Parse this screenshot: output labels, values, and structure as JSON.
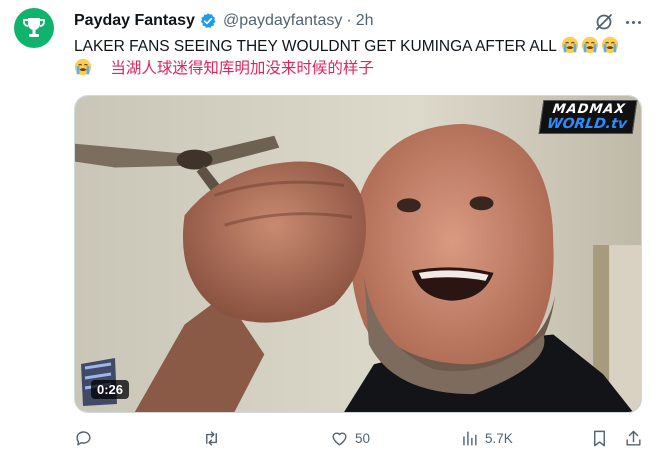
{
  "tweet": {
    "display_name": "Payday Fantasy",
    "handle": "@paydayfantasy",
    "separator": "·",
    "timestamp": "2h",
    "text_line1": "LAKER FANS SEEING THEY WOULDNT GET KUMINGA AFTER ALL",
    "text_line2": "当湖人球迷得知库明加没来时候的样子",
    "emojis": [
      "loudly-crying-face",
      "loudly-crying-face",
      "loudly-crying-face",
      "loudly-crying-face"
    ]
  },
  "media": {
    "watermark_line1": "MADMAX",
    "watermark_line2": "WORLD.tv",
    "duration": "0:26"
  },
  "actions": {
    "reply_count": "",
    "retweet_count": "",
    "like_count": "50",
    "views_count": "5.7K"
  },
  "colors": {
    "avatar_bg": "#10b36c",
    "verified": "#1d9bf0",
    "secondary_text": "#536471",
    "cn_text": "#e0245e"
  },
  "icons": [
    "verified-badge-icon",
    "grok-icon",
    "more-icon",
    "reply-icon",
    "retweet-icon",
    "like-icon",
    "views-icon",
    "bookmark-icon",
    "share-icon"
  ]
}
